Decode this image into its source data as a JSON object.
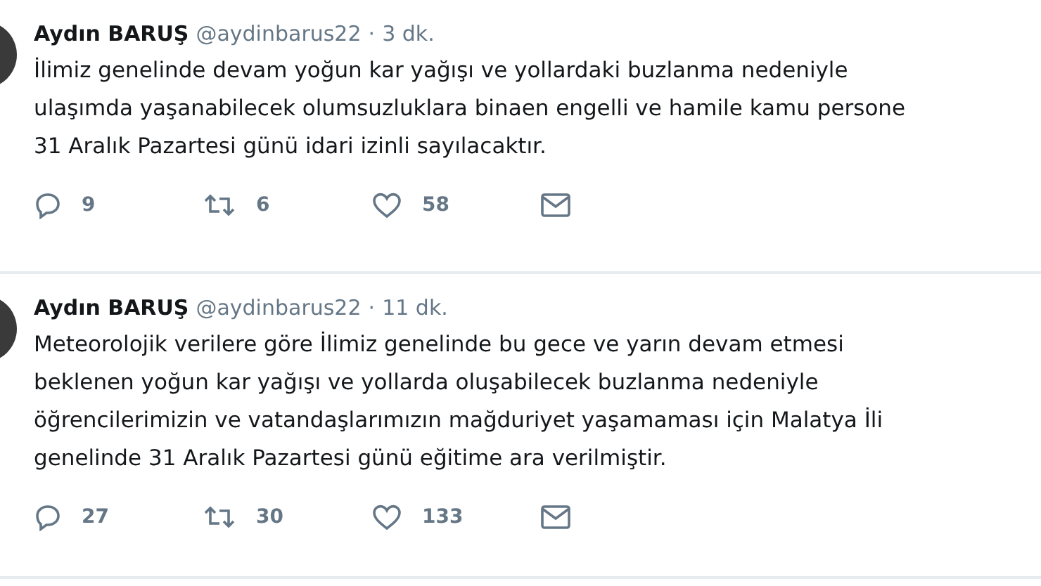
{
  "tweets": [
    {
      "name": "Aydın BARUŞ",
      "handle": "@aydinbarus22",
      "separator": "·",
      "time": "3 dk.",
      "lines": [
        "İlimiz genelinde devam yoğun kar yağışı ve yollardaki buzlanma nedeniyle",
        "ulaşımda yaşanabilecek olumsuzluklara binaen engelli ve hamile kamu persone",
        "31 Aralık Pazartesi günü idari izinli sayılacaktır."
      ],
      "replies": "9",
      "retweets": "6",
      "likes": "58"
    },
    {
      "name": "Aydın BARUŞ",
      "handle": "@aydinbarus22",
      "separator": "·",
      "time": "11 dk.",
      "lines": [
        "Meteorolojik verilere göre İlimiz genelinde bu gece ve yarın devam etmesi",
        "beklenen yoğun kar yağışı ve yollarda oluşabilecek buzlanma nedeniyle",
        "öğrencilerimizin ve vatandaşlarımızın mağduriyet yaşamaması için Malatya İli",
        "genelinde 31 Aralık Pazartesi günü eğitime ara verilmiştir."
      ],
      "replies": "27",
      "retweets": "30",
      "likes": "133"
    }
  ]
}
